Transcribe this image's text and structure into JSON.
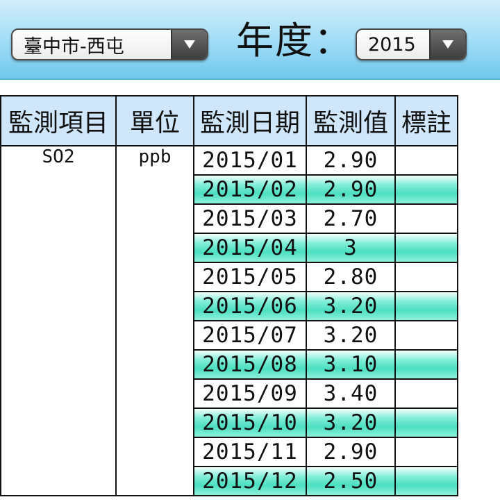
{
  "controls": {
    "city_value": "臺中市-西屯",
    "year_label": "年度：",
    "year_value": "2015"
  },
  "table": {
    "headers": [
      "監測項目",
      "單位",
      "監測日期",
      "監測值",
      "標註"
    ],
    "item": "SO2",
    "unit": "ppb",
    "rows": [
      {
        "date": "2015/01",
        "value": "2.90",
        "note": ""
      },
      {
        "date": "2015/02",
        "value": "2.90",
        "note": ""
      },
      {
        "date": "2015/03",
        "value": "2.70",
        "note": ""
      },
      {
        "date": "2015/04",
        "value": "3",
        "note": ""
      },
      {
        "date": "2015/05",
        "value": "2.80",
        "note": ""
      },
      {
        "date": "2015/06",
        "value": "3.20",
        "note": ""
      },
      {
        "date": "2015/07",
        "value": "3.20",
        "note": ""
      },
      {
        "date": "2015/08",
        "value": "3.10",
        "note": ""
      },
      {
        "date": "2015/09",
        "value": "3.40",
        "note": ""
      },
      {
        "date": "2015/10",
        "value": "3.20",
        "note": ""
      },
      {
        "date": "2015/11",
        "value": "2.90",
        "note": ""
      },
      {
        "date": "2015/12",
        "value": "2.50",
        "note": ""
      }
    ]
  },
  "colors": {
    "header_bg": "#cfe6fb",
    "stripe": "#4cdfc1",
    "topbar": "#9fdcf7"
  }
}
